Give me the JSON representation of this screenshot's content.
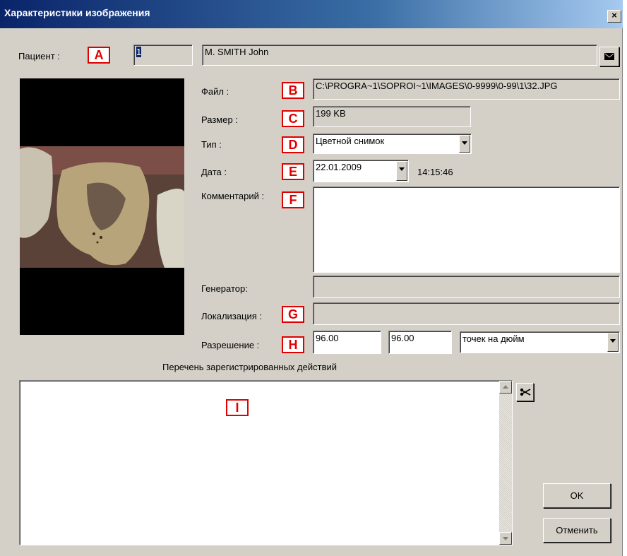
{
  "window": {
    "title": "Характеристики изображения",
    "close_glyph": "×"
  },
  "patient": {
    "label": "Пациент :",
    "badge": "A",
    "id": "1",
    "name": "M. SMITH John"
  },
  "file": {
    "label": "Файл :",
    "badge": "B",
    "value": "C:\\PROGRA~1\\SOPROI~1\\IMAGES\\0-9999\\0-99\\1\\32.JPG"
  },
  "size": {
    "label": "Размер :",
    "badge": "C",
    "value": "199 KB"
  },
  "type": {
    "label": "Тип :",
    "badge": "D",
    "value": "Цветной снимок"
  },
  "date": {
    "label": "Дата :",
    "badge": "E",
    "value": "22.01.2009",
    "time": "14:15:46"
  },
  "comment": {
    "label": "Комментарий :",
    "badge": "F",
    "value": ""
  },
  "generator": {
    "label": "Генератор:",
    "value": ""
  },
  "localization": {
    "label": "Локализация :",
    "badge": "G",
    "value": ""
  },
  "resolution": {
    "label": "Разрешение :",
    "badge": "H",
    "x": "96.00",
    "y": "96.00",
    "unit": "точек на дюйм"
  },
  "actions": {
    "title": "Перечень зарегистрированных действий",
    "badge": "I"
  },
  "buttons": {
    "ok": "OK",
    "cancel": "Отменить"
  },
  "icons": {
    "mail": "envelope-icon",
    "cut": "scissors-icon"
  }
}
